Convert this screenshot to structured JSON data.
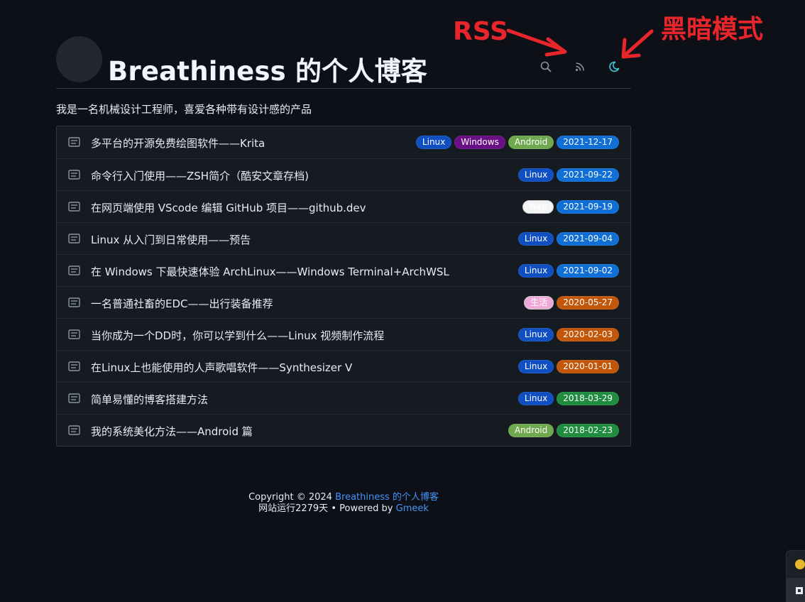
{
  "header": {
    "title": "Breathiness 的个人博客",
    "search_label": "搜索",
    "rss_label": "RSS",
    "theme_label": "黑暗模式"
  },
  "annotations": {
    "rss": "RSS",
    "dark_mode": "黑暗模式",
    "color": "#e8252a"
  },
  "description": "我是一名机械设计工程师，喜爱各种带有设计感的产品",
  "icons": {
    "search": "search-icon",
    "rss": "rss-icon",
    "theme": "moon-icon",
    "post": "post-icon"
  },
  "label_colors": {
    "Linux": "#0f4fc2",
    "Windows": "#6b0f86",
    "Android": "#6fa84e",
    "Web": "#f4f4f4",
    "生活": "#f0a8d8",
    "date_2021": "#0f6fd6",
    "date_2020": "#c2570a",
    "date_2018": "#1f8c3f"
  },
  "posts": [
    {
      "title": "多平台的开源免费绘图软件——Krita",
      "labels": [
        "Linux",
        "Windows",
        "Android"
      ],
      "date": "2021-12-17"
    },
    {
      "title": "命令行入门使用——ZSH简介（酷安文章存档)",
      "labels": [
        "Linux"
      ],
      "date": "2021-09-22"
    },
    {
      "title": "在网页端使用 VScode 编辑 GitHub 项目——github.dev",
      "labels": [
        "Web"
      ],
      "date": "2021-09-19"
    },
    {
      "title": "Linux 从入门到日常使用——预告",
      "labels": [
        "Linux"
      ],
      "date": "2021-09-04"
    },
    {
      "title": "在 Windows 下最快速体验 ArchLinux——Windows Terminal+ArchWSL",
      "labels": [
        "Linux"
      ],
      "date": "2021-09-02"
    },
    {
      "title": "一名普通社畜的EDC——出行装备推荐",
      "labels": [
        "生活"
      ],
      "date": "2020-05-27"
    },
    {
      "title": "当你成为一个DD时，你可以学到什么——Linux 视频制作流程",
      "labels": [
        "Linux"
      ],
      "date": "2020-02-03"
    },
    {
      "title": "在Linux上也能使用的人声歌唱软件——Synthesizer V",
      "labels": [
        "Linux"
      ],
      "date": "2020-01-01"
    },
    {
      "title": "简单易懂的博客搭建方法",
      "labels": [
        "Linux"
      ],
      "date": "2018-03-29"
    },
    {
      "title": "我的系统美化方法——Android 篇",
      "labels": [
        "Android"
      ],
      "date": "2018-02-23"
    }
  ],
  "footer": {
    "copyright_prefix": "Copyright © 2024",
    "site_link": "Breathiness 的个人博客",
    "runtime": "网站运行2279天",
    "powered_prefix": "• Powered by",
    "powered_link": "Gmeek"
  }
}
